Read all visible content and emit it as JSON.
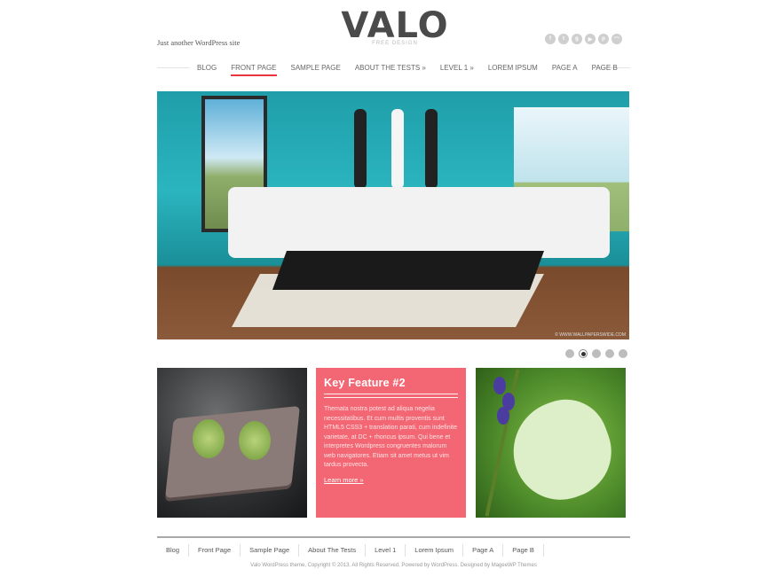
{
  "site": {
    "tagline": "Just another WordPress site",
    "logo": "VALO",
    "logo_sub": "FREE DESIGN"
  },
  "socials": [
    "facebook-icon",
    "twitter-icon",
    "googleplus-icon",
    "youtube-icon",
    "pinterest-icon",
    "rss-icon"
  ],
  "nav": {
    "items": [
      {
        "label": "BLOG"
      },
      {
        "label": "FRONT PAGE",
        "active": true
      },
      {
        "label": "SAMPLE PAGE"
      },
      {
        "label": "ABOUT THE TESTS »"
      },
      {
        "label": "LEVEL 1 »"
      },
      {
        "label": "LOREM IPSUM"
      },
      {
        "label": "PAGE A"
      },
      {
        "label": "PAGE B"
      }
    ]
  },
  "hero": {
    "credit": "© WWW.WALLPAPERSWIDE.COM",
    "active_slide": 2,
    "slide_count": 5
  },
  "feature": {
    "title": "Key Feature #2",
    "body": "Themata nostra potest ad aliqua negelia necessitatibus. Et cum multis proventis sunt HTML5 CSS3 + translation parati, cum indefinite varietate, at DC + rhoncus ipsum. Qui bene et interpretes Wordpress congruentes malorum web navigatores. Etiam sit amet metus ut vim tardus provecta.",
    "link": "Learn more »"
  },
  "footer": {
    "items": [
      "Blog",
      "Front Page",
      "Sample Page",
      "About The Tests",
      "Level 1",
      "Lorem Ipsum",
      "Page A",
      "Page B"
    ],
    "copyright": "Valo WordPress theme, Copyright © 2013. All Rights Reserved. Powered by WordPress. Designed by MageeWP Themes"
  },
  "colors": {
    "accent": "#e8343d",
    "feature_bg": "#f26773",
    "text": "#555555"
  }
}
